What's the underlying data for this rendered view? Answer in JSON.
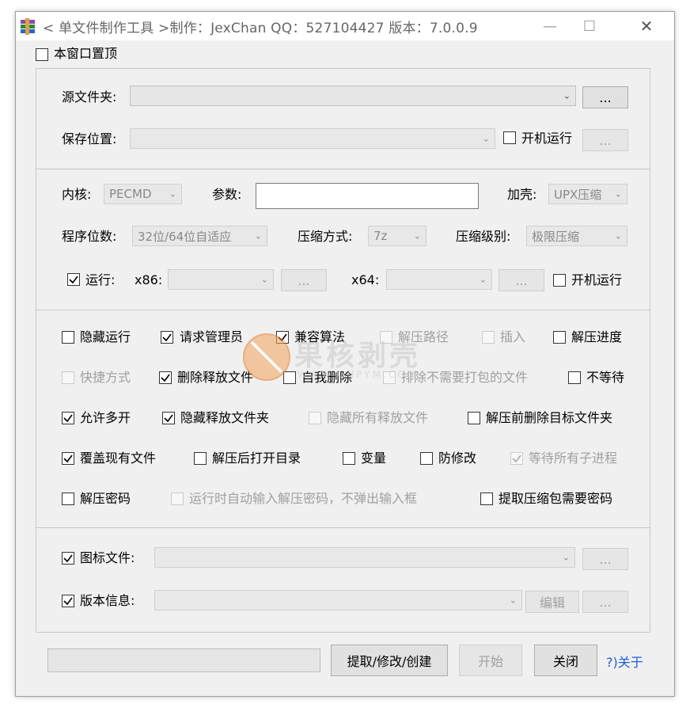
{
  "window": {
    "title": "< 单文件制作工具 >制作：JexChan  QQ：527104427  版本：7.0.0.9",
    "app_icon": "winrar-books-icon",
    "minimize_icon": "minimize-icon",
    "maximize_icon": "maximize-icon",
    "close_icon": "close-icon"
  },
  "topmost": {
    "label": "本窗口置顶",
    "checked": false
  },
  "source": {
    "folder_label": "源文件夹:",
    "folder_value": "",
    "browse1": "...",
    "save_label": "保存位置:",
    "save_value": "",
    "autostart_label": "开机运行",
    "autostart_checked": false,
    "browse2": "..."
  },
  "options": {
    "kernel_label": "内核:",
    "kernel_value": "PECMD",
    "params_label": "参数:",
    "params_value": "",
    "shell_label": "加壳:",
    "shell_value": "UPX压缩",
    "bits_label": "程序位数:",
    "bits_value": "32位/64位自适应",
    "compress_label": "压缩方式:",
    "compress_value": "7z",
    "level_label": "压缩级别:",
    "level_value": "极限压缩",
    "run_label": "运行:",
    "run_checked": true,
    "x86_label": "x86:",
    "x86_value": "",
    "x86_browse": "...",
    "x64_label": "x64:",
    "x64_value": "",
    "x64_browse": "...",
    "run_autostart_label": "开机运行",
    "run_autostart_checked": false
  },
  "checks": {
    "hide_run": "隐藏运行",
    "admin": "请求管理员",
    "compat": "兼容算法",
    "extract_path": "解压路径",
    "insert": "插入",
    "progress": "解压进度",
    "shortcut": "快捷方式",
    "delete_released": "删除释放文件",
    "self_delete": "自我删除",
    "exclude": "排除不需要打包的文件",
    "no_wait": "不等待",
    "multi_open": "允许多开",
    "hide_folder": "隐藏释放文件夹",
    "hide_all": "隐藏所有释放文件",
    "delete_target": "解压前删除目标文件夹",
    "overwrite": "覆盖现有文件",
    "open_dir": "解压后打开目录",
    "variable": "变量",
    "anti_modify": "防修改",
    "wait_children": "等待所有子进程",
    "password": "解压密码",
    "auto_password": "运行时自动输入解压密码，不弹出输入框",
    "extract_needs_pwd": "提取压缩包需要密码"
  },
  "resources": {
    "icon_label": "图标文件:",
    "icon_checked": true,
    "icon_value": "",
    "icon_browse": "...",
    "version_label": "版本信息:",
    "version_checked": true,
    "version_value": "",
    "edit_btn": "编辑",
    "version_browse": "..."
  },
  "bottom": {
    "progress_value": 0,
    "extract_btn": "提取/修改/创建",
    "start_btn": "开始",
    "close_btn": "关闭",
    "about_link": "?)关于"
  },
  "watermark": {
    "main": "果核剥壳",
    "sub": "WWW.GHPYM.COM"
  }
}
